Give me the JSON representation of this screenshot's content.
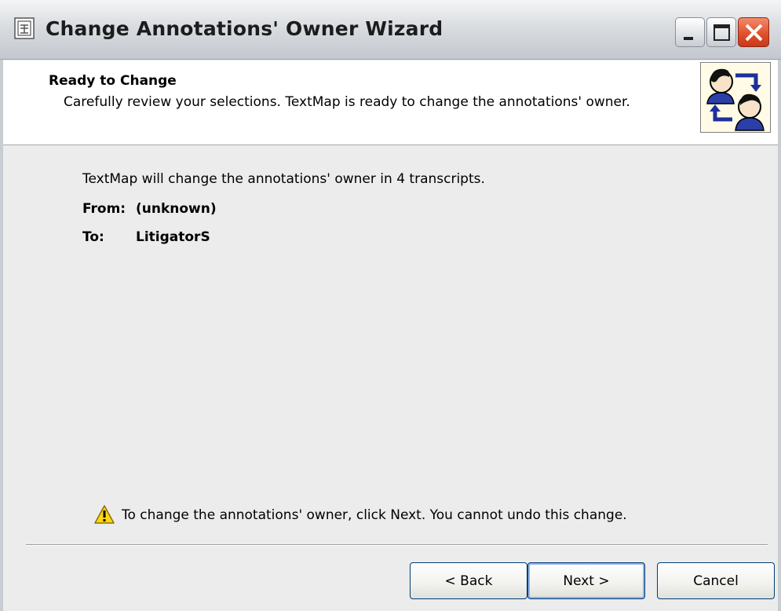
{
  "window": {
    "title": "Change Annotations' Owner Wizard",
    "icons": {
      "app": "wizard-app-icon",
      "minimize": "minimize-icon",
      "maximize": "maximize-icon",
      "close": "close-icon"
    }
  },
  "header": {
    "title": "Ready to Change",
    "description": "Carefully review your selections.  TextMap is ready to change the annotations' owner.",
    "image": "change-owner-people-icon"
  },
  "content": {
    "summary": "TextMap will change the annotations' owner in 4 transcripts.",
    "from_label": "From:",
    "from_value": "(unknown)",
    "to_label": "To:",
    "to_value": "LitigatorS"
  },
  "warning": {
    "icon": "warning-icon",
    "text": "To change the annotations' owner, click Next.  You cannot undo this change."
  },
  "buttons": {
    "back": "< Back",
    "next": "Next >",
    "cancel": "Cancel"
  },
  "colors": {
    "titlebar": "#d9dce0",
    "close": "#e0522d",
    "panel": "#ececec",
    "header_bg": "#ffffff"
  }
}
